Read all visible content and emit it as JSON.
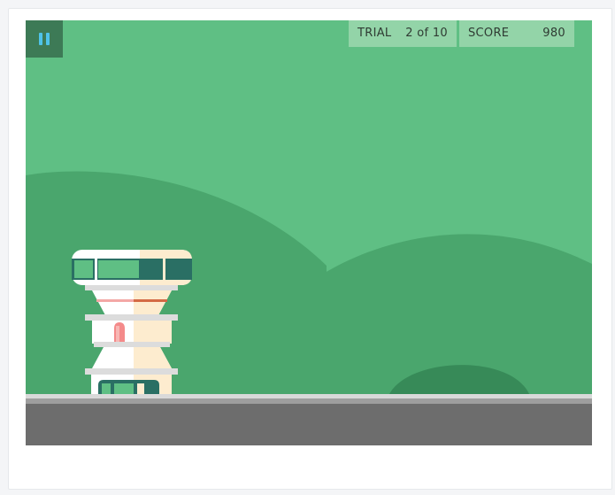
{
  "hud": {
    "trial_label": "TRIAL",
    "trial_value": "2 of 10",
    "score_label": "SCORE",
    "score_value": "980"
  },
  "icons": {
    "pause": "pause-icon"
  },
  "colors": {
    "sky": "#5fbf84",
    "hills": "#4aa66d",
    "small_hill": "#378a58",
    "road": "#6d6d6d",
    "pause_bg": "#3d7a56",
    "pause_icon": "#4fc3ea",
    "hud_bg": "#93d4a8"
  }
}
